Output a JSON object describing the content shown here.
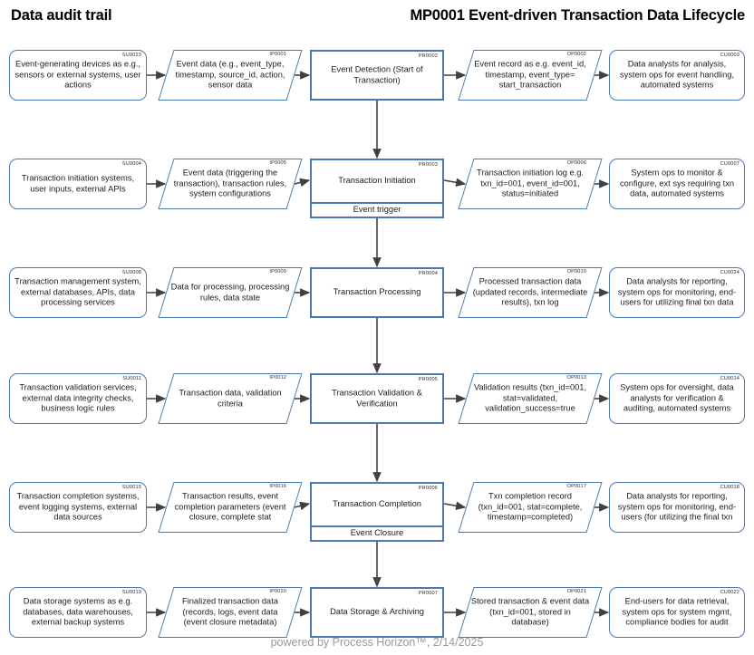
{
  "header": {
    "audit_title": "Data audit trail",
    "process_title": "MP0001 Event-driven Transaction Data Lifecycle"
  },
  "footer": {
    "text": "powered by Process Horizon™, 2/14/2025"
  },
  "colors": {
    "shape_border": "#4a79b0",
    "arrow": "#404040",
    "text": "#1c1c1c",
    "footer_text": "#9a9a9a"
  },
  "columns": [
    {
      "key": "supplier",
      "shape": "rounded-rect"
    },
    {
      "key": "input",
      "shape": "parallelogram"
    },
    {
      "key": "process",
      "shape": "rect"
    },
    {
      "key": "output",
      "shape": "parallelogram"
    },
    {
      "key": "customer",
      "shape": "rounded-rect"
    }
  ],
  "rows": [
    {
      "supplier": {
        "id": "SU0023",
        "text": "Event-generating devices as e.g., sensors or external systems, user actions"
      },
      "input": {
        "id": "IP0001",
        "text": "Event data (e.g., event_type, timestamp, source_id, action, sensor data"
      },
      "process": {
        "id": "PR0002",
        "text": "Event Detection (Start of Transaction)",
        "sub": null
      },
      "output": {
        "id": "OP0002",
        "text": "Event record as e.g. event_id, timestamp, event_type= start_transaction"
      },
      "customer": {
        "id": "CU0003",
        "text": "Data analysts for analysis, system ops for event handling, automated systems"
      }
    },
    {
      "supplier": {
        "id": "SU0004",
        "text": "Transaction initiation systems, user inputs, external APIs"
      },
      "input": {
        "id": "IP0005",
        "text": "Event data (triggering the transaction), transaction rules, system configurations"
      },
      "process": {
        "id": "PR0003",
        "text": "Transaction Initiation",
        "sub": "Event trigger"
      },
      "output": {
        "id": "OP0006",
        "text": "Transaction initiation log e.g. txn_id=001, event_id=001, status=initiated"
      },
      "customer": {
        "id": "CU0007",
        "text": "System ops to monitor & configure, ext sys requiring txn data, automated systems"
      }
    },
    {
      "supplier": {
        "id": "SU0008",
        "text": "Transaction management system, external databases, APIs, data processing services"
      },
      "input": {
        "id": "IP0009",
        "text": "Data for processing, processing rules, data state"
      },
      "process": {
        "id": "PR0004",
        "text": "Transaction Processing",
        "sub": null
      },
      "output": {
        "id": "OP0010",
        "text": "Processed transaction data (updated records, intermediate results), txn log"
      },
      "customer": {
        "id": "CU0024",
        "text": "Data analysts for reporting, system ops for monitoring, end-users for utilizing final txn data"
      }
    },
    {
      "supplier": {
        "id": "SU0011",
        "text": "Transaction validation services, external data integrity checks, business logic rules"
      },
      "input": {
        "id": "IP0012",
        "text": "Transaction data, validation criteria"
      },
      "process": {
        "id": "PR0005",
        "text": "Transaction Validation & Verification",
        "sub": null
      },
      "output": {
        "id": "OP0013",
        "text": "Validation results (txn_id=001, stat=validated, validation_success=true"
      },
      "customer": {
        "id": "CU0014",
        "text": "System ops for oversight, data analysts for verification & auditing, automated systems"
      }
    },
    {
      "supplier": {
        "id": "SU0015",
        "text": "Transaction completion systems, event logging systems, external data sources"
      },
      "input": {
        "id": "IP0016",
        "text": "Transaction results, event completion parameters (event closure, complete stat"
      },
      "process": {
        "id": "PR0006",
        "text": "Transaction Completion",
        "sub": "Event Closure"
      },
      "output": {
        "id": "OP0017",
        "text": "Txn completion record (txn_id=001, stat=complete, timestamp=completed)"
      },
      "customer": {
        "id": "CU0018",
        "text": "Data analysts for reporting, system ops for monitoring, end-users (for utilizing the final txn"
      }
    },
    {
      "supplier": {
        "id": "SU0019",
        "text": "Data storage systems as e.g. databases, data warehouses, external backup systems"
      },
      "input": {
        "id": "IP0020",
        "text": "Finalized transaction data (records, logs, event data (event closure metadata)"
      },
      "process": {
        "id": "PR0007",
        "text": "Data Storage & Archiving",
        "sub": null
      },
      "output": {
        "id": "OP0021",
        "text": "Stored transaction & event data (txn_id=001, stored in database)"
      },
      "customer": {
        "id": "CU0022",
        "text": "End-users for data retrieval, system ops for system mgmt, compliance bodies for audit"
      }
    }
  ]
}
